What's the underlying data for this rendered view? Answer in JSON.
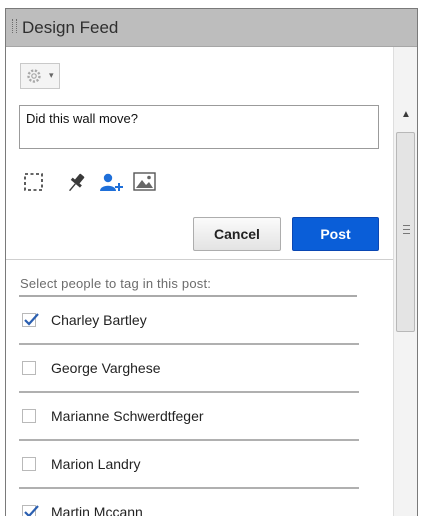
{
  "panel": {
    "title": "Design Feed"
  },
  "toolbar": {
    "settings_icon": "gear-icon",
    "settings_dropdown_icon": "chevron-down-icon"
  },
  "comment": {
    "value": "Did this wall move?"
  },
  "tools": [
    {
      "name": "rectangle-select-icon"
    },
    {
      "name": "pin-icon"
    },
    {
      "name": "tag-person-icon",
      "active_color": "#1e6fd9"
    },
    {
      "name": "image-icon"
    }
  ],
  "actions": {
    "cancel_label": "Cancel",
    "post_label": "Post",
    "post_color": "#0a5ed8"
  },
  "tagging": {
    "prompt": "Select people to tag in this post:",
    "people": [
      {
        "name": "Charley Bartley",
        "checked": true
      },
      {
        "name": "George Varghese",
        "checked": false
      },
      {
        "name": "Marianne Schwerdtfeger",
        "checked": false
      },
      {
        "name": "Marion Landry",
        "checked": false
      },
      {
        "name": "Martin Mccann",
        "checked": true
      }
    ]
  }
}
